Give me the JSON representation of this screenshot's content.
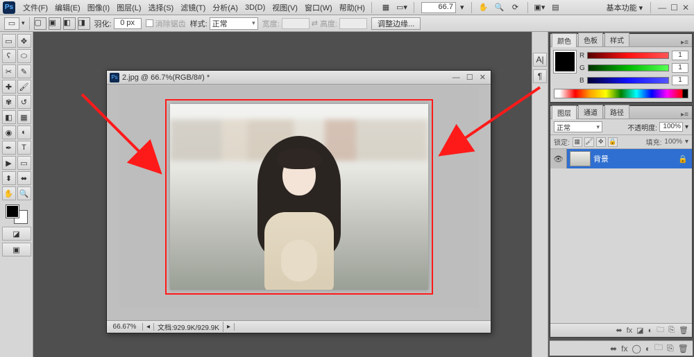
{
  "menu": {
    "items": [
      "文件(F)",
      "编辑(E)",
      "图像(I)",
      "图层(L)",
      "选择(S)",
      "滤镜(T)",
      "分析(A)",
      "3D(D)",
      "视图(V)",
      "窗口(W)",
      "帮助(H)"
    ],
    "zoom": "66.7",
    "workspace": "基本功能"
  },
  "options": {
    "feather_label": "羽化:",
    "feather_value": "0 px",
    "antialias_label": "消除锯齿",
    "style_label": "样式:",
    "style_value": "正常",
    "width_label": "宽度:",
    "height_label": "高度:",
    "refine_label": "调整边缘..."
  },
  "doc": {
    "title": "2.jpg @ 66.7%(RGB/8#) *",
    "zoom_pct": "66.67%",
    "status_label": "文档:",
    "status_value": "929.9K/929.9K"
  },
  "color_panel": {
    "tabs": [
      "颜色",
      "色板",
      "样式"
    ],
    "rgb": {
      "r_label": "R",
      "g_label": "G",
      "b_label": "B",
      "r": "1",
      "g": "1",
      "b": "1"
    }
  },
  "layers_panel": {
    "tabs": [
      "图层",
      "通道",
      "路径"
    ],
    "blend_mode": "正常",
    "opacity_label": "不透明度:",
    "opacity": "100%",
    "lock_label": "锁定:",
    "fill_label": "填充:",
    "fill": "100%",
    "layers": [
      {
        "name": "背景",
        "locked": true
      }
    ]
  },
  "chart_data": {
    "type": "none"
  }
}
